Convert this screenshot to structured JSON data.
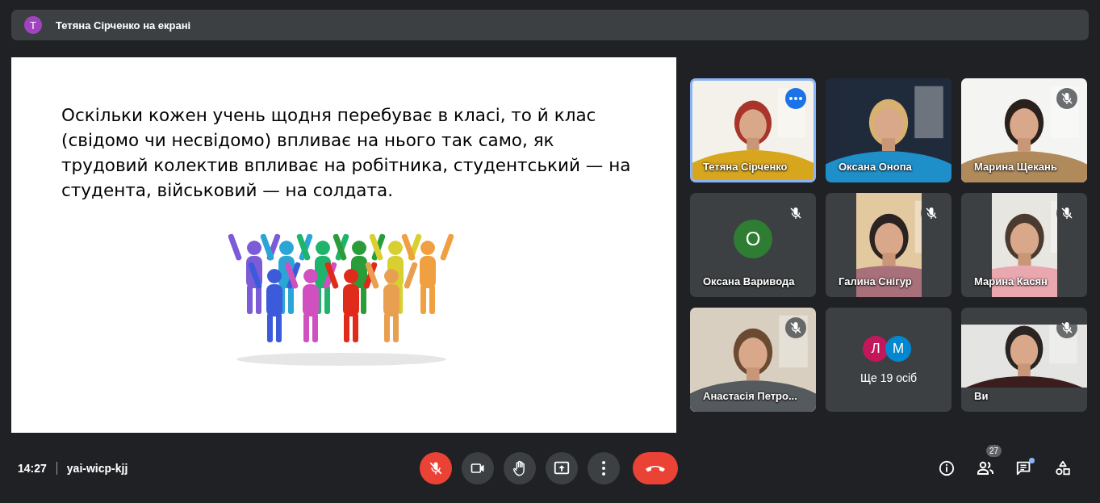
{
  "presenter_bar": {
    "avatar": "Т",
    "text": "Тетяна Сірченко на екрані"
  },
  "slide": {
    "text": "Оскільки кожен учень щодня перебуває в класі, то й клас (свідомо чи несвідомо) впливає на нього так само, як трудовий колектив впливає на робітника, студентський — на студента, військовий — на солдата."
  },
  "tiles": [
    {
      "kind": "video",
      "name": "Тетяна Сірченко",
      "active": true,
      "muted": false
    },
    {
      "kind": "video",
      "name": "Оксана Онопа",
      "active": false,
      "muted": false
    },
    {
      "kind": "video",
      "name": "Марина Щекань",
      "active": false,
      "muted": true
    },
    {
      "kind": "avatar",
      "letter": "О",
      "color": "#2e7d32",
      "name": "Оксана Варивода",
      "active": false,
      "muted": true
    },
    {
      "kind": "portrait",
      "name": "Галина Снігур",
      "active": false,
      "muted": true
    },
    {
      "kind": "portrait",
      "name": "Марина Касян",
      "active": false,
      "muted": true
    },
    {
      "kind": "video",
      "name": "Анастасія Петро...",
      "active": false,
      "muted": true
    },
    {
      "kind": "others",
      "avatars": [
        {
          "letter": "Л",
          "color": "#c2185b"
        },
        {
          "letter": "М",
          "color": "#0288d1"
        }
      ],
      "name": "Ще 19 осіб",
      "active": false,
      "muted": false
    },
    {
      "kind": "letterbox",
      "name": "Ви",
      "active": false,
      "muted": true
    }
  ],
  "bottom_bar": {
    "time": "14:27",
    "meeting_code": "yai-wicp-kjj",
    "controls": [
      {
        "kind": "mic",
        "muted": true
      },
      {
        "kind": "camera"
      },
      {
        "kind": "hand"
      },
      {
        "kind": "present"
      },
      {
        "kind": "more"
      },
      {
        "kind": "end"
      }
    ],
    "side_icons": [
      {
        "kind": "info"
      },
      {
        "kind": "people",
        "badge": "27"
      },
      {
        "kind": "chat",
        "dot": true
      },
      {
        "kind": "activities"
      }
    ]
  }
}
